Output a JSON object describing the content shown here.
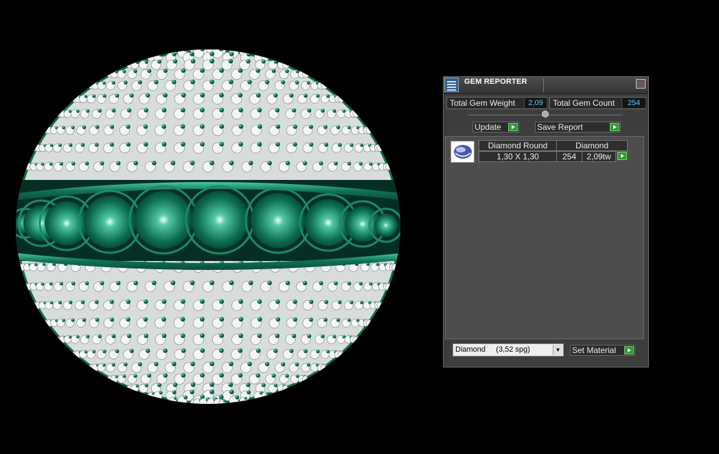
{
  "panel": {
    "title": "GEM REPORTER",
    "close_label": "×",
    "total_weight_label": "Total Gem Weight",
    "total_weight_value": "2,09",
    "total_count_label": "Total Gem Count",
    "total_count_value": "254",
    "update_label": "Update",
    "save_report_label": "Save Report",
    "gem_row": {
      "shape": "Diamond Round",
      "size": "1,30 X 1,30",
      "material": "Diamond",
      "count": "254",
      "weight": "2,09tw"
    },
    "material_select": "Diamond     (3,52 spg)",
    "set_material_label": "Set Material"
  },
  "colors": {
    "gem_green": "#0e7a5c",
    "value_cyan": "#5fc6ff",
    "play_green": "#2f9a2f"
  },
  "icons": {
    "app": "gem-reporter-icon",
    "close": "close-icon",
    "play": "play-arrow-icon",
    "dropdown": "chevron-down-icon",
    "gem_thumbnail": "round-gem-icon"
  }
}
